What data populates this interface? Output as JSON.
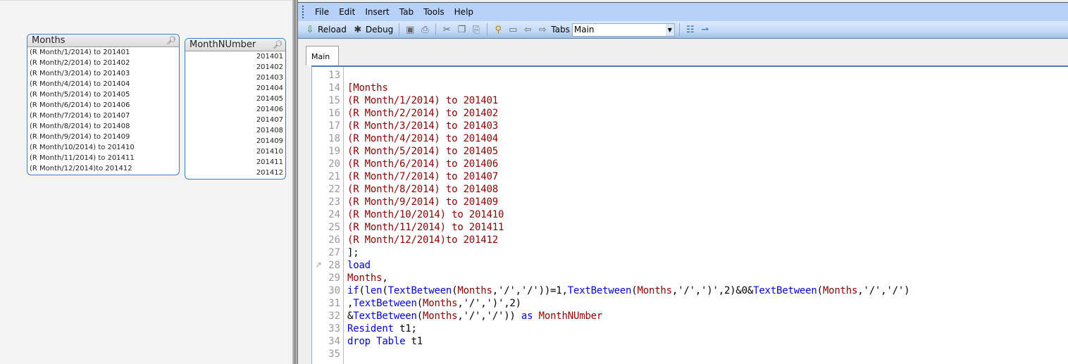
{
  "listboxes": [
    {
      "title": "Months",
      "values": [
        "(R Month/1/2014) to 201401",
        "(R Month/2/2014) to 201402",
        "(R Month/3/2014) to 201403",
        "(R Month/4/2014) to 201404",
        "(R Month/5/2014) to 201405",
        "(R Month/6/2014) to 201406",
        "(R Month/7/2014) to 201407",
        "(R Month/8/2014) to 201408",
        "(R Month/9/2014) to 201409",
        "(R Month/10/2014) to 201410",
        "(R Month/11/2014) to 201411",
        "(R Month/12/2014)to 201412"
      ]
    },
    {
      "title": "MonthNUmber",
      "values": [
        "201401",
        "201402",
        "201403",
        "201404",
        "201405",
        "201406",
        "201407",
        "201408",
        "201409",
        "201410",
        "201411",
        "201412"
      ]
    }
  ],
  "menu": [
    "File",
    "Edit",
    "Insert",
    "Tab",
    "Tools",
    "Help"
  ],
  "toolbar": {
    "reload": "Reload",
    "debug": "Debug",
    "tabs_label": "Tabs",
    "tabs_value": "Main"
  },
  "tab": "Main",
  "code": [
    {
      "n": "13",
      "t": []
    },
    {
      "n": "14",
      "t": [
        [
          "f",
          "[Months"
        ]
      ]
    },
    {
      "n": "15",
      "t": [
        [
          "f",
          "(R Month/1/2014) to 201401"
        ]
      ]
    },
    {
      "n": "16",
      "t": [
        [
          "f",
          "(R Month/2/2014) to 201402"
        ]
      ]
    },
    {
      "n": "17",
      "t": [
        [
          "f",
          "(R Month/3/2014) to 201403"
        ]
      ]
    },
    {
      "n": "18",
      "t": [
        [
          "f",
          "(R Month/4/2014) to 201404"
        ]
      ]
    },
    {
      "n": "19",
      "t": [
        [
          "f",
          "(R Month/5/2014) to 201405"
        ]
      ]
    },
    {
      "n": "20",
      "t": [
        [
          "f",
          "(R Month/6/2014) to 201406"
        ]
      ]
    },
    {
      "n": "21",
      "t": [
        [
          "f",
          "(R Month/7/2014) to 201407"
        ]
      ]
    },
    {
      "n": "22",
      "t": [
        [
          "f",
          "(R Month/8/2014) to 201408"
        ]
      ]
    },
    {
      "n": "23",
      "t": [
        [
          "f",
          "(R Month/9/2014) to 201409"
        ]
      ]
    },
    {
      "n": "24",
      "t": [
        [
          "f",
          "(R Month/10/2014) to 201410"
        ]
      ]
    },
    {
      "n": "25",
      "t": [
        [
          "f",
          "(R Month/11/2014) to 201411"
        ]
      ]
    },
    {
      "n": "26",
      "t": [
        [
          "f",
          "(R Month/12/2014)to 201412"
        ]
      ]
    },
    {
      "n": "27",
      "t": [
        [
          "p",
          "];"
        ]
      ]
    },
    {
      "n": "28",
      "t": [
        [
          "k",
          "load"
        ]
      ]
    },
    {
      "n": "29",
      "t": [
        [
          "f",
          "Months"
        ],
        [
          "p",
          ","
        ]
      ]
    },
    {
      "n": "30",
      "t": [
        [
          "k",
          "if"
        ],
        [
          "p",
          "("
        ],
        [
          "k",
          "len"
        ],
        [
          "p",
          "("
        ],
        [
          "k",
          "TextBetween"
        ],
        [
          "p",
          "("
        ],
        [
          "f",
          "Months"
        ],
        [
          "p",
          ",'/','/'))=1,"
        ],
        [
          "k",
          "TextBetween"
        ],
        [
          "p",
          "("
        ],
        [
          "f",
          "Months"
        ],
        [
          "p",
          ",'/',')',2)&0&"
        ],
        [
          "k",
          "TextBetween"
        ],
        [
          "p",
          "("
        ],
        [
          "f",
          "Months"
        ],
        [
          "p",
          ",'/','/')"
        ]
      ]
    },
    {
      "n": "31",
      "t": [
        [
          "p",
          ","
        ],
        [
          "k",
          "TextBetween"
        ],
        [
          "p",
          "("
        ],
        [
          "f",
          "Months"
        ],
        [
          "p",
          ",'/',')',2)"
        ]
      ]
    },
    {
      "n": "32",
      "t": [
        [
          "p",
          "&"
        ],
        [
          "k",
          "TextBetween"
        ],
        [
          "p",
          "("
        ],
        [
          "f",
          "Months"
        ],
        [
          "p",
          ",'/','/')) "
        ],
        [
          "k",
          "as"
        ],
        [
          "p",
          " "
        ],
        [
          "f",
          "MonthNUmber"
        ]
      ]
    },
    {
      "n": "33",
      "t": [
        [
          "k",
          "Resident"
        ],
        [
          "p",
          " t1;"
        ]
      ]
    },
    {
      "n": "34",
      "t": [
        [
          "k",
          "drop"
        ],
        [
          "p",
          " "
        ],
        [
          "k",
          "Table"
        ],
        [
          "p",
          " t1"
        ]
      ]
    },
    {
      "n": "35",
      "t": []
    }
  ]
}
